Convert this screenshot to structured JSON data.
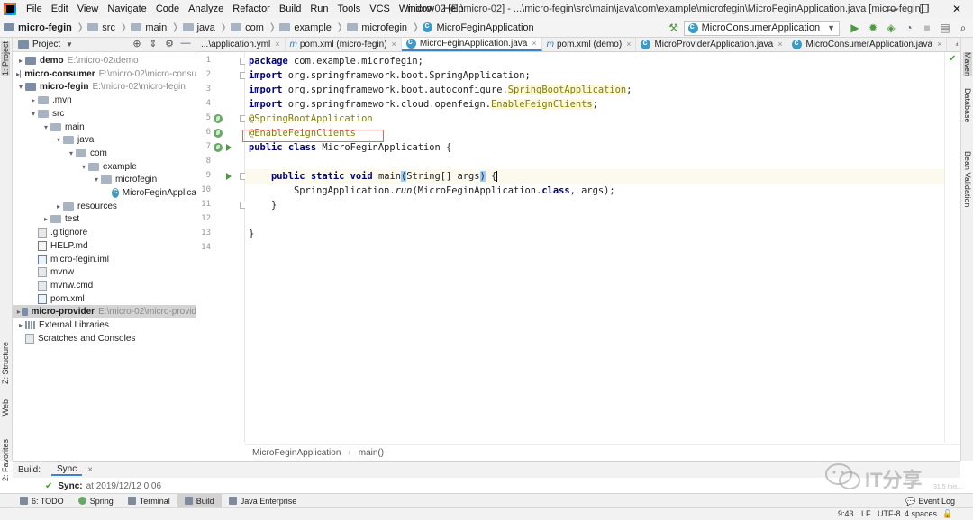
{
  "menu": [
    "File",
    "Edit",
    "View",
    "Navigate",
    "Code",
    "Analyze",
    "Refactor",
    "Build",
    "Run",
    "Tools",
    "VCS",
    "Window",
    "Help"
  ],
  "window_title": "micro-02 [E:\\micro-02] - ...\\micro-fegin\\src\\main\\java\\com\\example\\microfegin\\MicroFeginApplication.java [micro-fegin]",
  "window_buttons": {
    "minimize": "—",
    "restore": "❐",
    "close": "✕"
  },
  "breadcrumb": [
    "micro-fegin",
    "src",
    "main",
    "java",
    "com",
    "example",
    "microfegin",
    "MicroFeginApplication"
  ],
  "run_config": "MicroConsumerApplication",
  "toolbar_icons": [
    "hammer-icon",
    "run-icon",
    "debug-icon",
    "coverage-icon",
    "profile-icon",
    "stop-icon",
    "structure-icon",
    "search-icon"
  ],
  "project_panel": {
    "title": "Project",
    "tree": [
      {
        "label": "demo",
        "path": "E:\\micro-02\\demo",
        "module": true,
        "chev": "▸"
      },
      {
        "label": "micro-consumer",
        "path": "E:\\micro-02\\micro-consu",
        "module": true,
        "chev": "▸"
      },
      {
        "label": "micro-fegin",
        "path": "E:\\micro-02\\micro-fegin",
        "module": true,
        "chev": "▾"
      },
      {
        "label": ".mvn",
        "chev": "▸"
      },
      {
        "label": "src",
        "chev": "▾"
      },
      {
        "label": "main",
        "chev": "▾"
      },
      {
        "label": "java",
        "chev": "▾"
      },
      {
        "label": "com",
        "chev": "▾"
      },
      {
        "label": "example",
        "chev": "▾"
      },
      {
        "label": "microfegin",
        "chev": "▾"
      },
      {
        "label": "MicroFeginApplica"
      },
      {
        "label": "resources",
        "chev": "▸"
      },
      {
        "label": "test",
        "chev": "▸"
      },
      {
        "label": ".gitignore"
      },
      {
        "label": "HELP.md"
      },
      {
        "label": "micro-fegin.iml"
      },
      {
        "label": "mvnw"
      },
      {
        "label": "mvnw.cmd"
      },
      {
        "label": "pom.xml"
      },
      {
        "label": "micro-provider",
        "path": "E:\\micro-02\\micro-provid",
        "module": true,
        "chev": "▸"
      },
      {
        "label": "External Libraries",
        "chev": "▸"
      },
      {
        "label": "Scratches and Consoles"
      }
    ]
  },
  "left_strip": {
    "project": "1: Project",
    "structure": "Z: Structure",
    "web": "Web",
    "favorites": "2: Favorites"
  },
  "right_strip": {
    "maven": "Maven",
    "database": "Database",
    "bean_validation": "Bean Validation"
  },
  "tabs": [
    {
      "label": "...\\application.yml",
      "prefix": ""
    },
    {
      "label": "pom.xml (micro-fegin)",
      "prefix": "m"
    },
    {
      "label": "MicroFeginApplication.java",
      "prefix": "",
      "active": true
    },
    {
      "label": "pom.xml (demo)",
      "prefix": "m"
    },
    {
      "label": "MicroProviderApplication.java",
      "prefix": ""
    },
    {
      "label": "MicroConsumerApplication.java",
      "prefix": ""
    }
  ],
  "tab_overflow": "⁴",
  "editor": {
    "line_numbers": [
      "1",
      "2",
      "3",
      "4",
      "5",
      "6",
      "7",
      "8",
      "9",
      "10",
      "11",
      "12",
      "13",
      "14"
    ],
    "line1": {
      "kw": "package",
      "rest": " com.example.microfegin;"
    },
    "line2": {
      "kw": "import",
      "rest": " org.springframework.boot.SpringApplication;"
    },
    "line3": {
      "kw": "import",
      "rest": " org.springframework.boot.autoconfigure.",
      "hl": "SpringBootApplication",
      "end": ";"
    },
    "line4": {
      "kw": "import",
      "rest": " org.springframework.cloud.openfeign.",
      "hl": "EnableFeignClients",
      "end": ";"
    },
    "line5": "@SpringBootApplication",
    "line6": "@EnableFeignClients",
    "line7": {
      "kw1": "public",
      "kw2": "class",
      "rest": " MicroFeginApplication {"
    },
    "line9": {
      "indent": "    ",
      "kw1": "public",
      "kw2": "static",
      "kw3": "void",
      "name": " main",
      "paren_open": "(",
      "args": "String[] args",
      "paren_close": ")",
      "space": " ",
      "brace": "{"
    },
    "line10": {
      "indent": "        SpringApplication.",
      "method": "run",
      "args": "(MicroFeginApplication.",
      "kw": "class",
      "end": ", args);"
    },
    "line11": "    }",
    "line13": "}"
  },
  "editor_breadcrumb": [
    "MicroFeginApplication",
    "main()"
  ],
  "build_panel": {
    "title": "Build:",
    "tab": "Sync",
    "status_bold": "Sync:",
    "status_text": "at 2019/12/12 0:06"
  },
  "bottom_tools": [
    {
      "label": "6: TODO"
    },
    {
      "label": "Spring"
    },
    {
      "label": "Terminal"
    },
    {
      "label": "Build",
      "active": true
    },
    {
      "label": "Java Enterprise"
    }
  ],
  "event_log": "Event Log",
  "status": {
    "position": "9:43",
    "line_sep": "LF",
    "encoding": "UTF-8",
    "indent": "4 spaces"
  },
  "watermark": {
    "text": "IT分享",
    "small": "31.5 this..."
  },
  "colors": {
    "keyword": "#000080",
    "annotation": "#808000",
    "accent": "#4083c9",
    "gutter_icon": "#6aa86a"
  }
}
